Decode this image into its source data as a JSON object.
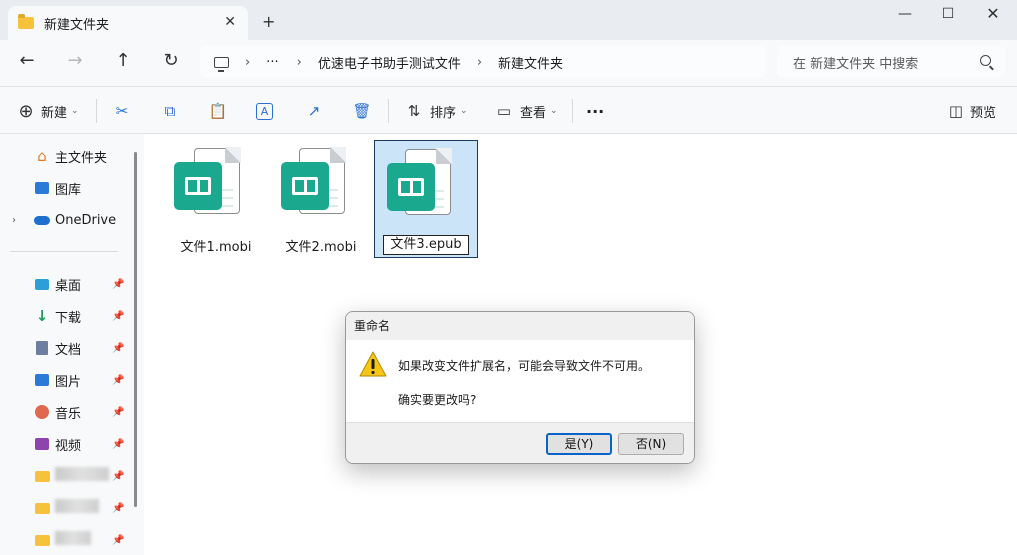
{
  "window": {
    "tab_title": "新建文件夹",
    "tab_close": "✕",
    "new_tab": "+",
    "minimize": "—",
    "maximize": "☐",
    "close": "✕"
  },
  "address": {
    "back": "←",
    "forward": "→",
    "up": "↑",
    "refresh": "↻",
    "chevron": "›",
    "ellipsis": "···",
    "crumbs": [
      "优速电子书助手测试文件",
      "新建文件夹"
    ],
    "search_placeholder": "在 新建文件夹 中搜索"
  },
  "toolbar": {
    "new_label": "新建",
    "sort_label": "排序",
    "view_label": "查看",
    "more": "···",
    "preview_label": "预览"
  },
  "sidebar": {
    "top_items": [
      {
        "label": "主文件夹",
        "icon": "home-icon"
      },
      {
        "label": "图库",
        "icon": "gallery-icon"
      },
      {
        "label": "OneDrive",
        "icon": "cloud-icon"
      }
    ],
    "expander": "›",
    "pin": "📌",
    "quick_items": [
      {
        "label": "桌面",
        "icon": "desktop-icon",
        "color": "#2b9fd6"
      },
      {
        "label": "下载",
        "icon": "download-icon",
        "color": "#1a9c5a"
      },
      {
        "label": "文档",
        "icon": "document-icon",
        "color": "#6d7ea0"
      },
      {
        "label": "图片",
        "icon": "pictures-icon",
        "color": "#2a7ad6"
      },
      {
        "label": "音乐",
        "icon": "music-icon",
        "color": "#e0684f"
      },
      {
        "label": "视频",
        "icon": "video-icon",
        "color": "#8e44ad"
      }
    ]
  },
  "files": [
    {
      "name": "文件1.mobi",
      "selected": false
    },
    {
      "name": "文件2.mobi",
      "selected": false
    },
    {
      "name": "文件3.epub",
      "selected": true
    }
  ],
  "dialog": {
    "title": "重命名",
    "message": "如果改变文件扩展名，可能会导致文件不可用。",
    "question": "确实要更改吗?",
    "yes_label": "是(Y)",
    "no_label": "否(N)"
  },
  "colors": {
    "accent": "#0a64c8",
    "badge": "#1aa88f",
    "folder": "#f7c23b",
    "selection": "#cce4f7"
  }
}
